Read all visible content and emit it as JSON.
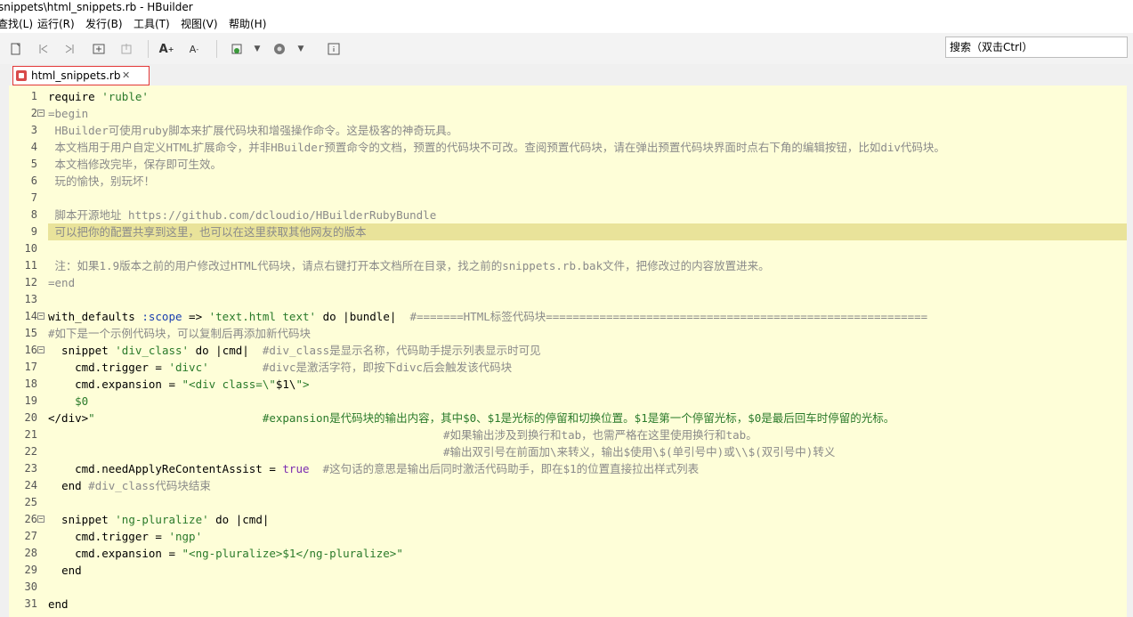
{
  "window": {
    "title": "snippets\\html_snippets.rb  -  HBuilder"
  },
  "menu": [
    "查找(L)",
    "运行(R)",
    "发行(B)",
    "工具(T)",
    "视图(V)",
    "帮助(H)"
  ],
  "search": {
    "placeholder": "搜索（双击Ctrl）"
  },
  "tab": {
    "label": "html_snippets.rb",
    "close": "✕"
  },
  "colors": {
    "editor_bg": "#fefed8",
    "highlight": "#e9e39a",
    "string": "#2a7a2a",
    "comment": "#8a8a8a",
    "keyword": "#7a2bb0",
    "symbol": "#1a3fb0",
    "tab_border": "#e23636"
  },
  "lines": [
    {
      "n": "1",
      "text": "require 'ruble'"
    },
    {
      "n": "2",
      "text": "=begin",
      "fold": true
    },
    {
      "n": "3",
      "text": " HBuilder可使用ruby脚本来扩展代码块和增强操作命令。这是极客的神奇玩具。"
    },
    {
      "n": "4",
      "text": " 本文档用于用户自定义HTML扩展命令，并非HBuilder预置命令的文档，预置的代码块不可改。查阅预置代码块，请在弹出预置代码块界面时点右下角的编辑按钮，比如div代码块。"
    },
    {
      "n": "5",
      "text": " 本文档修改完毕，保存即可生效。"
    },
    {
      "n": "6",
      "text": " 玩的愉快，别玩坏！"
    },
    {
      "n": "7",
      "text": ""
    },
    {
      "n": "8",
      "text": " 脚本开源地址 https://github.com/dcloudio/HBuilderRubyBundle"
    },
    {
      "n": "9",
      "text": " 可以把你的配置共享到这里，也可以在这里获取其他网友的版本",
      "highlight": true
    },
    {
      "n": "10",
      "text": ""
    },
    {
      "n": "11",
      "text": " 注：如果1.9版本之前的用户修改过HTML代码块，请点右键打开本文档所在目录，找之前的snippets.rb.bak文件，把修改过的内容放置进来。"
    },
    {
      "n": "12",
      "text": "=end"
    },
    {
      "n": "13",
      "text": ""
    },
    {
      "n": "14",
      "text": "with_defaults :scope => 'text.html text' do |bundle|  #=======HTML标签代码块=========================================================",
      "fold": true
    },
    {
      "n": "15",
      "text": "#如下是一个示例代码块，可以复制后再添加新代码块"
    },
    {
      "n": "16",
      "text": "  snippet 'div_class' do |cmd|  #div_class是显示名称，代码助手提示列表显示时可见",
      "fold": true
    },
    {
      "n": "17",
      "text": "    cmd.trigger = 'divc'        #divc是激活字符，即按下divc后会触发该代码块"
    },
    {
      "n": "18",
      "text": "    cmd.expansion = \"<div class=\\\"$1\\\">"
    },
    {
      "n": "19",
      "text": "    $0"
    },
    {
      "n": "20",
      "text": "</div>\"                         #expansion是代码块的输出内容，其中$0、$1是光标的停留和切换位置。$1是第一个停留光标，$0是最后回车时停留的光标。"
    },
    {
      "n": "21",
      "text": "                                                           #如果输出涉及到换行和tab，也需严格在这里使用换行和tab。"
    },
    {
      "n": "22",
      "text": "                                                           #输出双引号在前面加\\来转义，输出$使用\\$(单引号中)或\\\\$(双引号中)转义"
    },
    {
      "n": "23",
      "text": "    cmd.needApplyReContentAssist = true  #这句话的意思是输出后同时激活代码助手，即在$1的位置直接拉出样式列表"
    },
    {
      "n": "24",
      "text": "  end #div_class代码块结束"
    },
    {
      "n": "25",
      "text": ""
    },
    {
      "n": "26",
      "text": "  snippet 'ng-pluralize' do |cmd|",
      "fold": true
    },
    {
      "n": "27",
      "text": "    cmd.trigger = 'ngp'"
    },
    {
      "n": "28",
      "text": "    cmd.expansion = \"<ng-pluralize>$1</ng-pluralize>\""
    },
    {
      "n": "29",
      "text": "  end"
    },
    {
      "n": "30",
      "text": ""
    },
    {
      "n": "31",
      "text": "end"
    }
  ]
}
